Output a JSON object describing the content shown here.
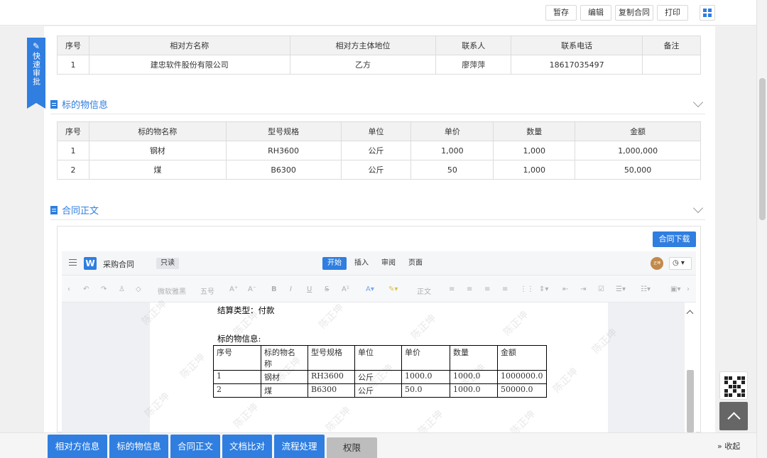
{
  "toolbar": {
    "save": "暂存",
    "edit": "编辑",
    "copy": "复制合同",
    "print": "打印"
  },
  "quick_approve": {
    "label": "快速审批"
  },
  "counterparty_table": {
    "headers": [
      "序号",
      "相对方名称",
      "相对方主体地位",
      "联系人",
      "联系电话",
      "备注"
    ],
    "rows": [
      [
        "1",
        "建忠软件股份有限公司",
        "乙方",
        "廖萍萍",
        "18617035497",
        ""
      ]
    ]
  },
  "subject_section": {
    "title": "标的物信息"
  },
  "subject_table": {
    "headers": [
      "序号",
      "标的物名称",
      "型号规格",
      "单位",
      "单价",
      "数量",
      "金额"
    ],
    "rows": [
      [
        "1",
        "钢材",
        "RH3600",
        "公斤",
        "1,000",
        "1,000",
        "1,000,000"
      ],
      [
        "2",
        "煤",
        "B6300",
        "公斤",
        "50",
        "1,000",
        "50,000"
      ]
    ]
  },
  "contract_section": {
    "title": "合同正文",
    "download": "合同下载"
  },
  "editor": {
    "logo": "W",
    "doc_name": "采购合同",
    "mode": "只读",
    "tabs": [
      "开始",
      "插入",
      "审阅",
      "页面"
    ],
    "active_tab": "开始",
    "avatar": "正坤",
    "font_name": "微软雅黑",
    "font_size": "五号",
    "style": "正文"
  },
  "document": {
    "settlement": "结算类型：付款",
    "subject_label": "标的物信息:",
    "table": {
      "headers": [
        "序号",
        "标的物名\n称",
        "型号规格",
        "单位",
        "单价",
        "数量",
        "金额"
      ],
      "rows": [
        [
          "1",
          "钢材",
          "RH3600",
          "公斤",
          "1000.0",
          "1000.0",
          "1000000.0"
        ],
        [
          "2",
          "煤",
          "B6300",
          "公斤",
          "50.0",
          "1000.0",
          "50000.0"
        ]
      ]
    },
    "watermark": "陈正坤"
  },
  "bottom_tabs": [
    "相对方信息",
    "标的物信息",
    "合同正文",
    "文档比对",
    "流程处理",
    "权限"
  ],
  "collapse_label": "收起",
  "colors": {
    "accent": "#2f7ee0",
    "inactive_tab": "#bdbdbd"
  }
}
